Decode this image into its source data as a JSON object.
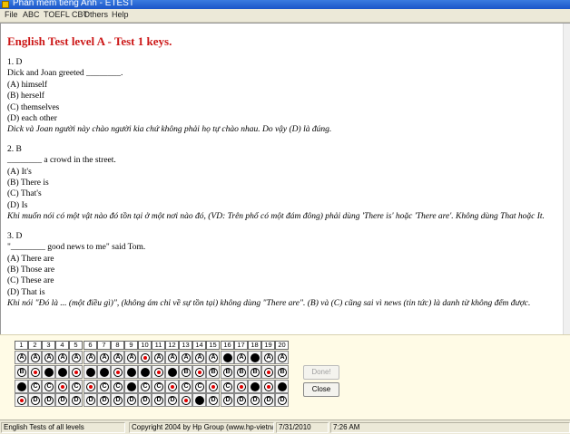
{
  "window": {
    "title": "Phan mem tieng Anh - ETEST"
  },
  "menu": {
    "items": [
      "File",
      "ABC",
      "TOEFL CBT",
      "Others",
      "Help"
    ]
  },
  "doc": {
    "title": "English Test level A - Test 1 keys.",
    "questions": [
      {
        "key": "1. D",
        "stem": "Dick and Joan greeted ________.",
        "options": [
          "(A) himself",
          "(B) herself",
          "(C) themselves",
          "(D) each other"
        ],
        "explanation": "Dick và Joan người này chào người kia chứ không phải họ tự chào nhau. Do vậy (D) là đúng."
      },
      {
        "key": "2. B",
        "stem": "________ a crowd in the street.",
        "options": [
          "(A) It's",
          "(B) There is",
          "(C) That's",
          "(D) Is"
        ],
        "explanation": "Khi muốn nói có một vật nào đó tồn tại ở một nơi nào đó, (VD: Trên phố có một đám đông) phải dùng 'There is' hoặc 'There are'. Không dùng That hoặc It."
      },
      {
        "key": "3. D",
        "stem": "\"________ good news to me\" said Tom.",
        "options": [
          "(A) There are",
          "(B) Those are",
          "(C) These are",
          "(D) That is"
        ],
        "explanation": "Khi nói \"Đó là ... (một điều gì)\", (không ám chỉ về sự tồn tại) không dùng \"There are\". (B) và (C) cũng sai vì news (tin tức) là danh từ không đếm được."
      }
    ]
  },
  "answer_sheet": {
    "numbers": [
      "1",
      "2",
      "3",
      "4",
      "5",
      "6",
      "7",
      "8",
      "9",
      "10",
      "11",
      "12",
      "13",
      "14",
      "15",
      "16",
      "17",
      "18",
      "19",
      "20"
    ],
    "letters": [
      "A",
      "B",
      "C",
      "D"
    ],
    "rows": [
      [
        "o",
        "o",
        "o",
        "o",
        "o",
        "o",
        "o",
        "o",
        "o",
        "m",
        "o",
        "o",
        "o",
        "o",
        "o",
        "f",
        "o",
        "f",
        "o",
        "o"
      ],
      [
        "o",
        "m",
        "f",
        "f",
        "m",
        "f",
        "f",
        "m",
        "f",
        "f",
        "m",
        "f",
        "o",
        "m",
        "o",
        "o",
        "o",
        "o",
        "m",
        "o"
      ],
      [
        "f",
        "o",
        "o",
        "m",
        "o",
        "m",
        "o",
        "o",
        "f",
        "o",
        "o",
        "m",
        "o",
        "o",
        "m",
        "o",
        "m",
        "f",
        "m",
        "f"
      ],
      [
        "m",
        "o",
        "o",
        "o",
        "o",
        "o",
        "o",
        "o",
        "o",
        "o",
        "o",
        "o",
        "m",
        "f",
        "o",
        "o",
        "o",
        "o",
        "o",
        "o"
      ]
    ],
    "buttons": {
      "done": "Done!",
      "close": "Close"
    }
  },
  "status": {
    "app": "English Tests of all levels",
    "copyright": "Copyright 2004 by Hp Group (www.hp-vietnam.com)",
    "date": "7/31/2010",
    "time": "7:26 AM"
  }
}
